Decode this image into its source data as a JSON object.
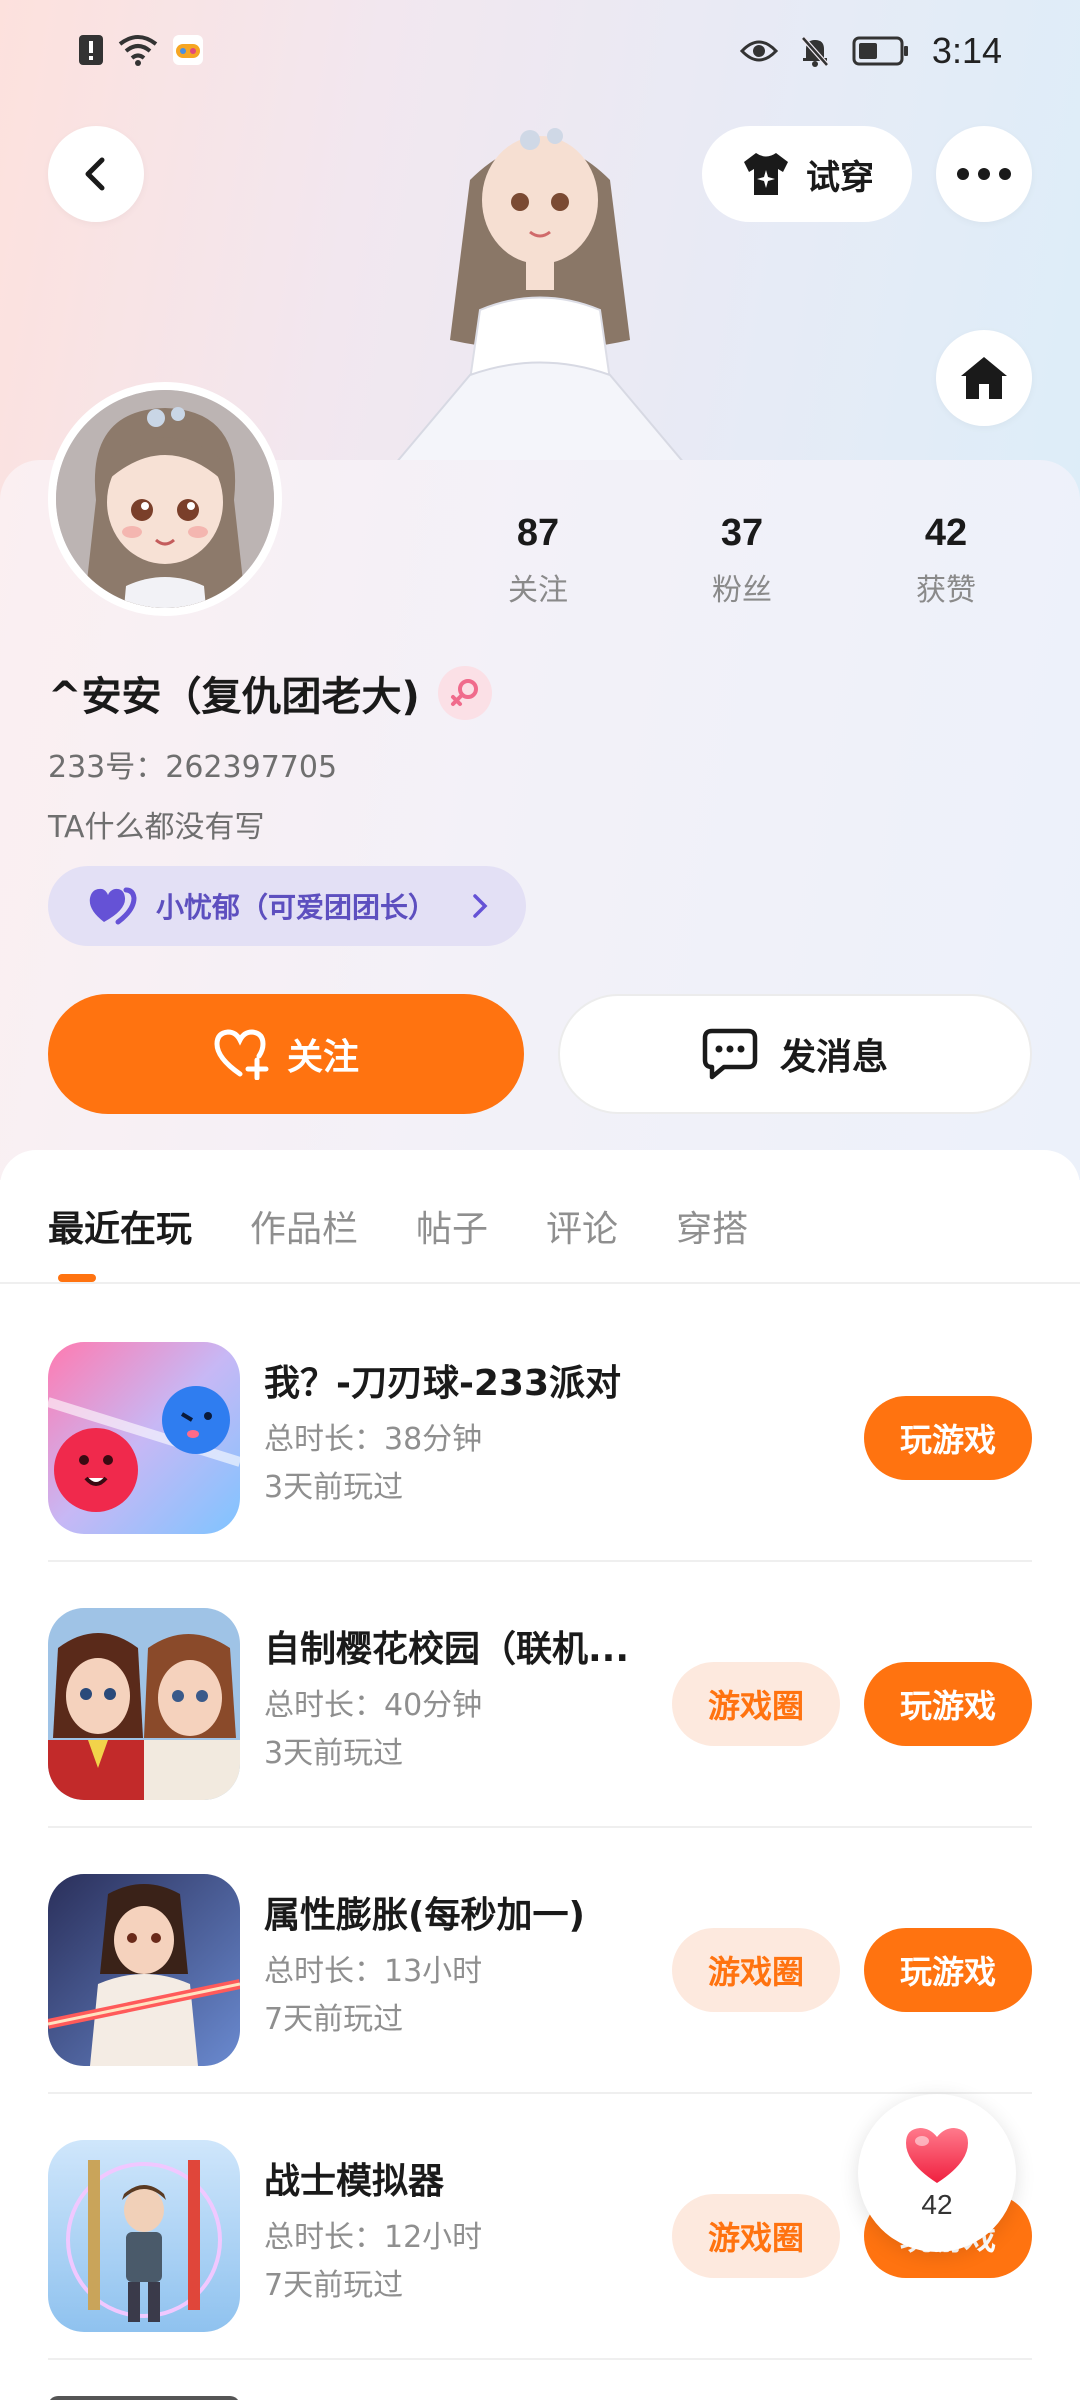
{
  "status_bar": {
    "time": "3:14",
    "left_icons": [
      "alert-sim-icon",
      "wifi-icon",
      "game-app-icon"
    ],
    "right_icons": [
      "eye-icon",
      "bell-muted-icon",
      "battery-icon"
    ]
  },
  "header": {
    "back_icon": "chevron-left-icon",
    "try_on_label": "试穿",
    "more_icon": "more-dots-icon",
    "home_icon": "home-icon"
  },
  "profile": {
    "name": "^安安（复仇团老大)",
    "gender_icon": "female-icon",
    "id_label": "233号：262397705",
    "bio": "TA什么都没有写",
    "group_label": "小忧郁（可爱团团长）",
    "stats": [
      {
        "value": "87",
        "label": "关注"
      },
      {
        "value": "37",
        "label": "粉丝"
      },
      {
        "value": "42",
        "label": "获赞"
      }
    ]
  },
  "actions": {
    "follow_label": "关注",
    "message_label": "发消息"
  },
  "tabs": [
    {
      "label": "最近在玩",
      "active": true
    },
    {
      "label": "作品栏",
      "active": false
    },
    {
      "label": "帖子",
      "active": false
    },
    {
      "label": "评论",
      "active": false
    },
    {
      "label": "穿搭",
      "active": false
    }
  ],
  "games": [
    {
      "title": "我？-刀刃球-233派对",
      "duration": "总时长：38分钟",
      "last_played": "3天前玩过",
      "play_label": "玩游戏",
      "circle_label": null
    },
    {
      "title": "自制樱花校园（联机...",
      "duration": "总时长：40分钟",
      "last_played": "3天前玩过",
      "play_label": "玩游戏",
      "circle_label": "游戏圈"
    },
    {
      "title": "属性膨胀(每秒加一)",
      "duration": "总时长：13小时",
      "last_played": "7天前玩过",
      "play_label": "玩游戏",
      "circle_label": "游戏圈"
    },
    {
      "title": "战士模拟器",
      "duration": "总时长：12小时",
      "last_played": "7天前玩过",
      "play_label": "玩游戏",
      "circle_label": "游戏圈"
    }
  ],
  "like_fab": {
    "count": "42",
    "icon": "heart-icon"
  },
  "colors": {
    "accent": "#ff7310",
    "chip_bg": "#fde9de",
    "group_chip_bg": "#e3e0f5",
    "group_text": "#5d4fbf"
  }
}
